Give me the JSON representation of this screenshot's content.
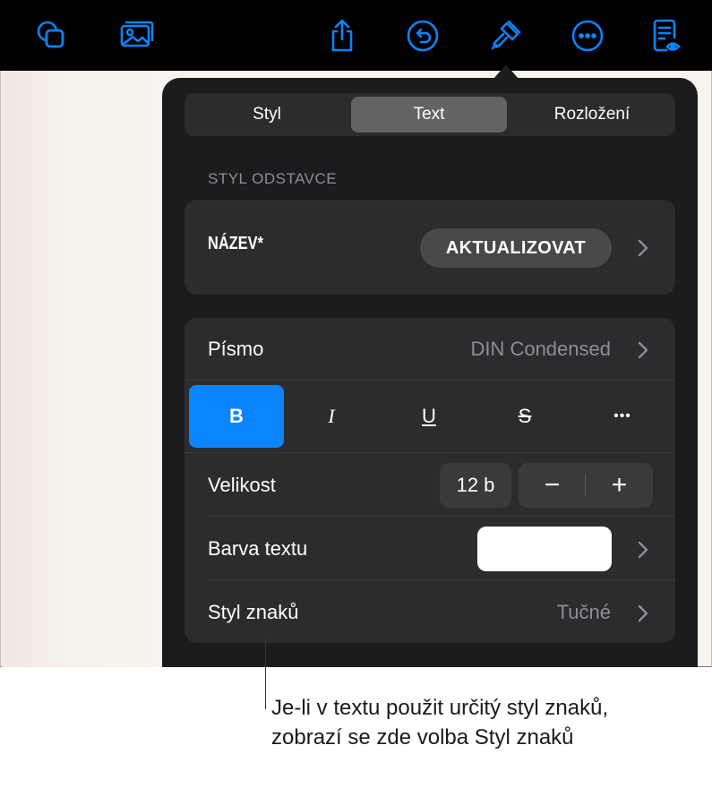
{
  "toolbar": {
    "icons": [
      "shapes-icon",
      "media-icon",
      "share-icon",
      "undo-icon",
      "format-brush-icon",
      "more-icon",
      "reading-view-icon"
    ]
  },
  "tabs": [
    "Styl",
    "Text",
    "Rozložení"
  ],
  "active_tab": "Text",
  "paragraph_style": {
    "header": "STYL ODSTAVCE",
    "name": "NÁZEV*",
    "update_label": "AKTUALIZOVAT"
  },
  "font": {
    "label": "Písmo",
    "value": "DIN Condensed"
  },
  "format_buttons": [
    "B",
    "I",
    "U",
    "S",
    "•••"
  ],
  "size": {
    "label": "Velikost",
    "value": "12 b",
    "minus": "−",
    "plus": "+"
  },
  "text_color": {
    "label": "Barva textu",
    "swatch": "#ffffff"
  },
  "char_style": {
    "label": "Styl znaků",
    "value": "Tučné"
  },
  "callout": "Je-li v textu použit určitý styl znaků, zobrazí se zde volba Styl znaků",
  "colors": {
    "accent": "#0a84ff",
    "popover_bg": "#1c1c1e",
    "card_bg": "#2c2c2e"
  }
}
